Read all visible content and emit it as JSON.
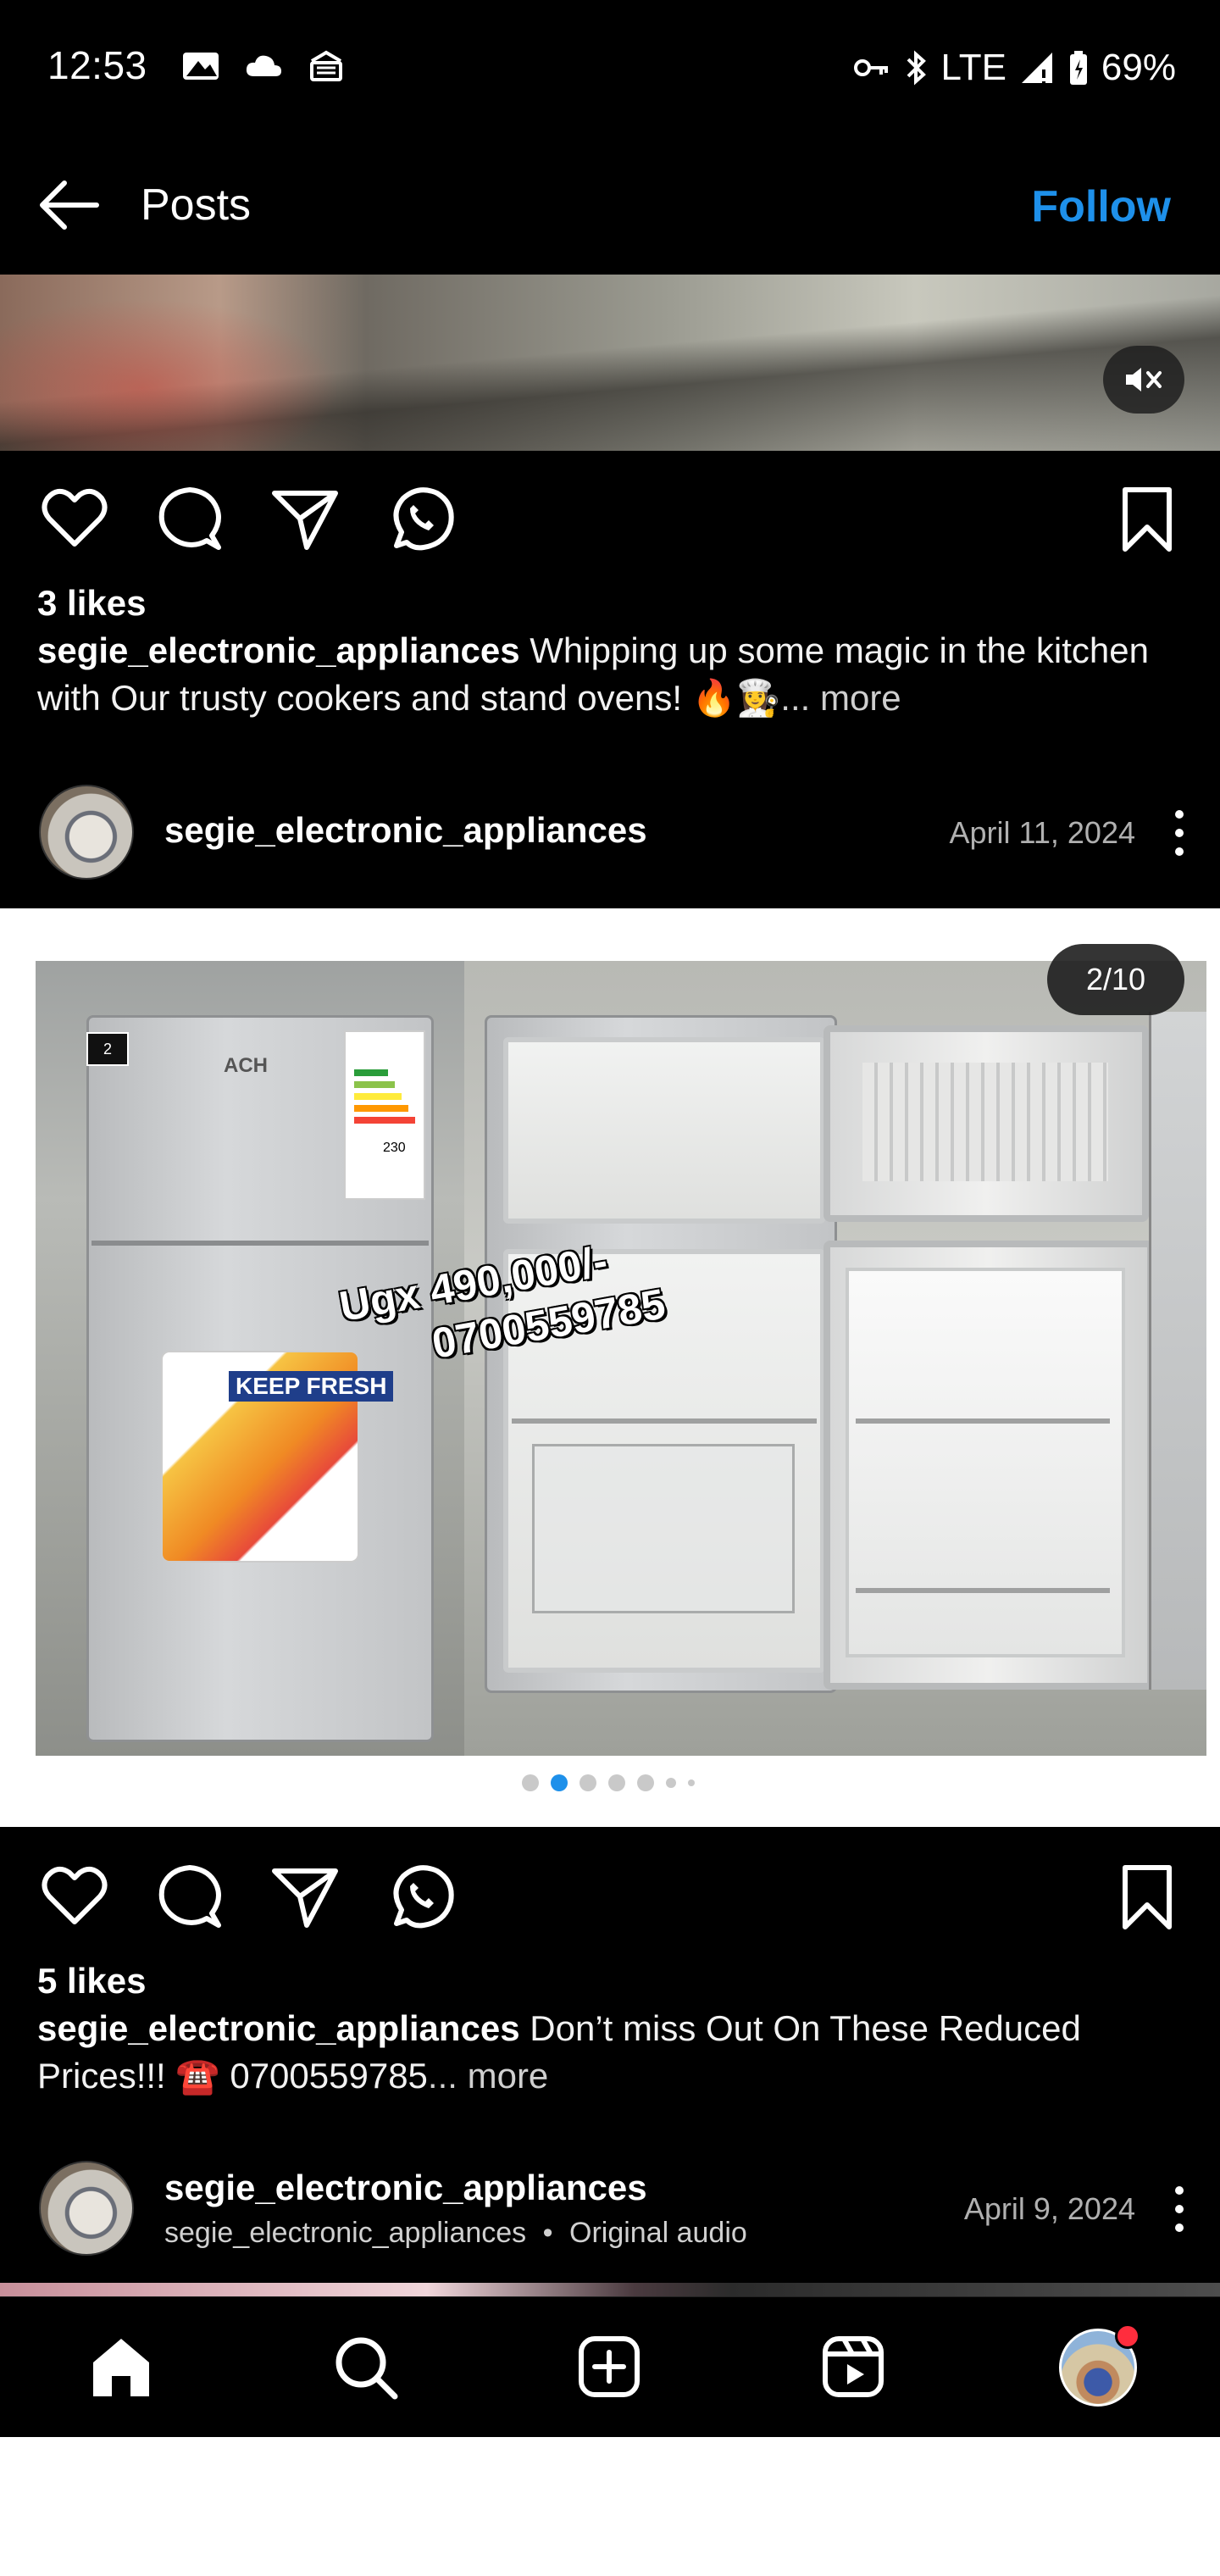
{
  "status_bar": {
    "time": "12:53",
    "network": "LTE",
    "battery": "69%",
    "left_icons": [
      "gallery-icon",
      "cloud-icon",
      "cast-icon"
    ],
    "right_icons": [
      "key-icon",
      "bluetooth-icon",
      "signal-icon",
      "battery-icon"
    ]
  },
  "header": {
    "title": "Posts",
    "follow_label": "Follow",
    "back_icon": "arrow-left-icon"
  },
  "post1": {
    "likes": "3 likes",
    "username": "segie_electronic_appliances",
    "caption": " Whipping up some magic in the kitchen with Our trusty cookers and stand ovens! 🔥👩‍🍳",
    "more": "... more"
  },
  "post2_header": {
    "username": "segie_electronic_appliances",
    "date": "April 11, 2024"
  },
  "post2_media": {
    "slide_counter": "2/10",
    "price_line1": "Ugx 490,000/-",
    "price_line2": "0700559785",
    "brand": "ACH",
    "sticker_text": "KEEP FRESH",
    "energy_number": "230",
    "warranty": "2",
    "active_slide_index": 2,
    "total_dots_visible": 7
  },
  "post2": {
    "likes": "5 likes",
    "username": "segie_electronic_appliances",
    "caption": " Don’t miss Out On These Reduced Prices!!! ☎️ 0700559785",
    "more": "... more"
  },
  "post3_header": {
    "username": "segie_electronic_appliances",
    "subtitle_user": "segie_electronic_appliances",
    "subtitle_sep": "•",
    "subtitle_audio": "Original audio",
    "date": "April 9, 2024"
  },
  "bottom_nav": {
    "items": [
      "home-icon",
      "search-icon",
      "create-icon",
      "reels-icon",
      "profile-avatar"
    ]
  },
  "colors": {
    "accent": "#1e90ea",
    "background": "#000000",
    "notification": "#ff2d3d"
  }
}
